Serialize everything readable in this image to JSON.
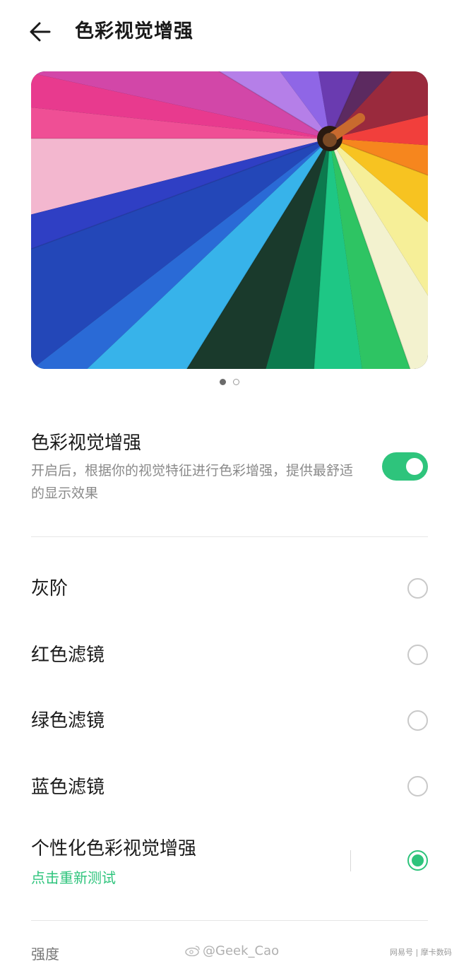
{
  "header": {
    "title": "色彩视觉增强",
    "back_icon": "arrow-left-icon"
  },
  "hero": {
    "carousel": {
      "page_count": 2,
      "active_index": 0
    }
  },
  "main_setting": {
    "title": "色彩视觉增强",
    "description": "开启后，根据你的视觉特征进行色彩增强，提供最舒适的显示效果",
    "enabled": true
  },
  "options": [
    {
      "label": "灰阶",
      "selected": false
    },
    {
      "label": "红色滤镜",
      "selected": false
    },
    {
      "label": "绿色滤镜",
      "selected": false
    },
    {
      "label": "蓝色滤镜",
      "selected": false
    },
    {
      "label": "个性化色彩视觉增强",
      "sublabel": "点击重新测试",
      "selected": true
    }
  ],
  "strength": {
    "label": "强度"
  },
  "watermark": {
    "text": "@Geek_Cao",
    "icon": "weibo-icon"
  },
  "footer_brand": "网易号 | 摩卡数码",
  "colors": {
    "accent": "#2ec47c",
    "text": "#1a1a1a",
    "secondary": "#8a8a8a"
  }
}
